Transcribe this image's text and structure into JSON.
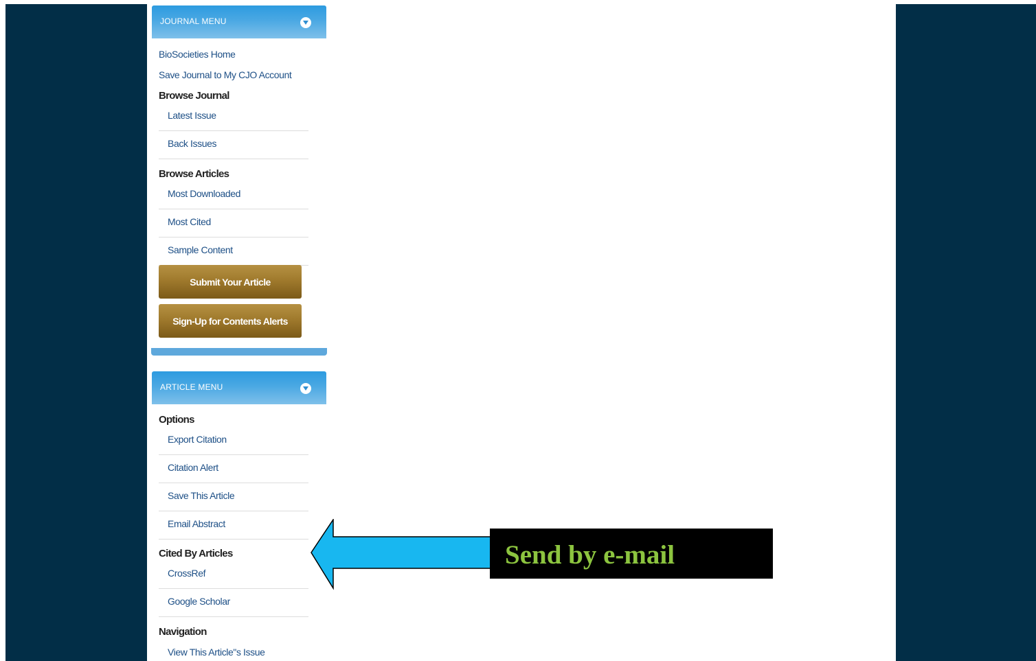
{
  "colors": {
    "background_band": "#022e47",
    "menu_header": "#3fa3e2",
    "gold_button": "#a07a2d",
    "link": "#1d4f86",
    "callout_bg": "#000000",
    "callout_text": "#8cc43f",
    "arrow_fill": "#18b7f0"
  },
  "journal_menu": {
    "title": "JOURNAL MENU",
    "toggle_icon": "chevron-down-icon",
    "links": [
      "BioSocieties Home",
      "Save Journal to My CJO Account"
    ],
    "browse_journal": {
      "heading": "Browse Journal",
      "items": [
        "Latest Issue",
        "Back Issues"
      ]
    },
    "browse_articles": {
      "heading": "Browse Articles",
      "items": [
        "Most Downloaded",
        "Most Cited",
        "Sample Content"
      ]
    },
    "buttons": [
      "Submit Your Article",
      "Sign-Up for Contents Alerts"
    ]
  },
  "article_menu": {
    "title": "ARTICLE MENU",
    "toggle_icon": "chevron-down-icon",
    "options": {
      "heading": "Options",
      "items": [
        "Export Citation",
        "Citation Alert",
        "Save This Article",
        "Email Abstract"
      ]
    },
    "cited_by": {
      "heading": "Cited By Articles",
      "items": [
        "CrossRef",
        "Google Scholar"
      ]
    },
    "navigation": {
      "heading": "Navigation",
      "items": [
        "View This Article\"s Issue"
      ]
    }
  },
  "callout": {
    "text": "Send by e-mail",
    "icon": "arrow-left-icon"
  }
}
